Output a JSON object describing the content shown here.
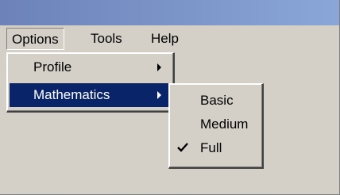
{
  "menubar": {
    "items": [
      {
        "label": "Options"
      },
      {
        "label": "Tools"
      },
      {
        "label": "Help"
      }
    ]
  },
  "options_menu": {
    "items": [
      {
        "label": "Profile",
        "has_submenu": true
      },
      {
        "label": "Mathematics",
        "has_submenu": true,
        "highlighted": true
      }
    ]
  },
  "mathematics_submenu": {
    "items": [
      {
        "label": "Basic",
        "checked": false
      },
      {
        "label": "Medium",
        "checked": false
      },
      {
        "label": "Full",
        "checked": true
      }
    ]
  },
  "colors": {
    "highlight": "#0a246a",
    "menu_face": "#d4d0c8",
    "titlebar": "#6c82b8"
  }
}
